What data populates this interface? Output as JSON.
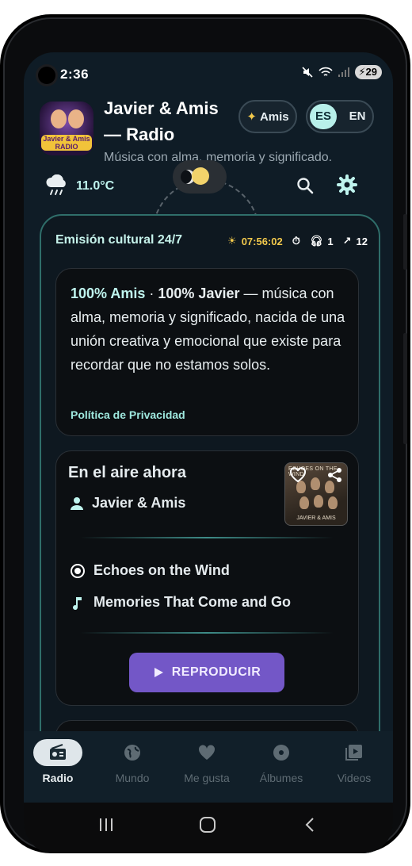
{
  "status_bar": {
    "time": "2:36",
    "battery": "29"
  },
  "header": {
    "logo_text": [
      "Javier & Amis",
      "RADIO"
    ],
    "title": "Javier & Amis — Radio",
    "subtitle": "Música con alma, memoria y significado.",
    "amis_button_label": "Amis",
    "lang": {
      "selected": "ES",
      "other": "EN"
    }
  },
  "weather": {
    "temperature": "11.0°C"
  },
  "broadcast": {
    "title": "Emisión cultural 24/7",
    "clock": "07:56:02",
    "listeners": "1",
    "trend": "12"
  },
  "intro": {
    "highlight_1": "100% Amis",
    "sep": " · ",
    "highlight_2": "100% Javier",
    "text": " — música con alma, memoria y significado, nacida de una unión creativa y emocional que existe para recordar que no estamos solos.",
    "privacy_link": "Política de Privacidad"
  },
  "now_playing": {
    "title": "En el aire ahora",
    "artist": "Javier & Amis",
    "album_title": "ECHOES ON THE WIND",
    "album_artist": "JAVIER & AMIS",
    "album": "Echoes on the Wind",
    "track": "Memories That Come and Go",
    "play_label": "REPRODUCIR"
  },
  "bottom_nav": [
    {
      "label": "Radio",
      "icon": "radio-icon",
      "active": true
    },
    {
      "label": "Mundo",
      "icon": "globe-icon",
      "active": false
    },
    {
      "label": "Me gusta",
      "icon": "heart-icon",
      "active": false
    },
    {
      "label": "Álbumes",
      "icon": "album-icon",
      "active": false
    },
    {
      "label": "Videos",
      "icon": "video-icon",
      "active": false
    }
  ],
  "colors": {
    "accent_teal": "#bff4ee",
    "accent_purple": "#7357c7",
    "clock_gold": "#f2c94c"
  }
}
